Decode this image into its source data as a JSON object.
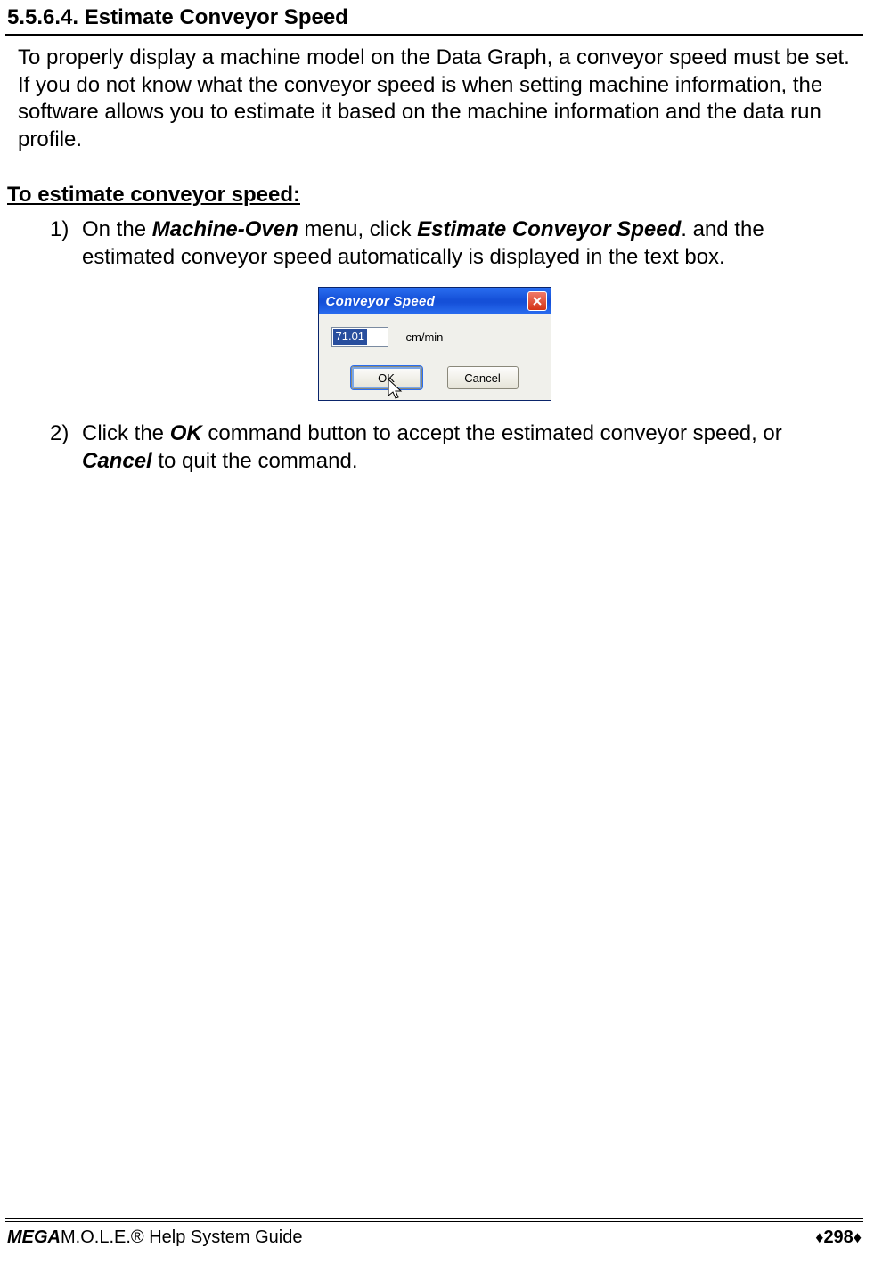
{
  "section": {
    "number": "5.5.6.4.",
    "title": "Estimate Conveyor Speed"
  },
  "intro": "To properly display a machine model on the Data Graph, a conveyor speed must be set. If you do not know what the conveyor speed is when setting machine information, the software allows you to estimate it based on the machine information and the data run profile.",
  "subheading": "To estimate conveyor speed:",
  "steps": [
    {
      "num": "1)",
      "pre": "On the ",
      "em1": "Machine-Oven",
      "mid1": " menu, click ",
      "em2": "Estimate Conveyor Speed",
      "post": ". and the estimated conveyor speed automatically is displayed in the text box."
    },
    {
      "num": "2)",
      "pre": "Click the ",
      "em1": "OK",
      "mid1": " command button to accept the estimated conveyor speed, or ",
      "em2": "Cancel",
      "post": " to quit the command."
    }
  ],
  "dialog": {
    "title": "Conveyor Speed",
    "value": "71.01",
    "unit": "cm/min",
    "ok": "OK",
    "cancel": "Cancel"
  },
  "footer": {
    "left_bold": "MEGA",
    "left_rest": "M.O.L.E.® Help System Guide",
    "page": "298"
  }
}
